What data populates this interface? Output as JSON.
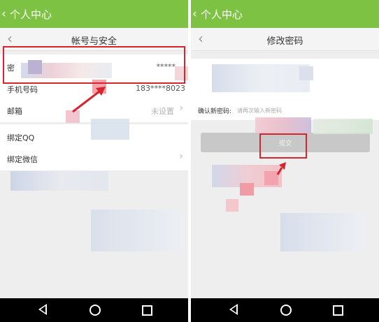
{
  "left": {
    "topbar": {
      "title": "个人中心"
    },
    "header": {
      "title": "帐号与安全"
    },
    "rows": [
      {
        "label": "密",
        "value": "*****"
      },
      {
        "label": "手机号码",
        "value": "183****8023"
      },
      {
        "label": "邮箱",
        "value": "未设置"
      },
      {
        "label": "绑定QQ",
        "value": ""
      },
      {
        "label": "绑定微信",
        "value": ""
      }
    ]
  },
  "right": {
    "topbar": {
      "title": "个人中心"
    },
    "header": {
      "title": "修改密码"
    },
    "confirm": {
      "label": "确认新密码:",
      "placeholder": "请再次输入新密码"
    },
    "submit_label": "提交"
  },
  "colors": {
    "topbar": "#7dc242",
    "highlight": "#d6252e",
    "background": "#eeeeee"
  },
  "icons": [
    "chevron-left-icon",
    "back-icon",
    "home-icon",
    "recent-apps-icon",
    "arrow-right-icon"
  ]
}
